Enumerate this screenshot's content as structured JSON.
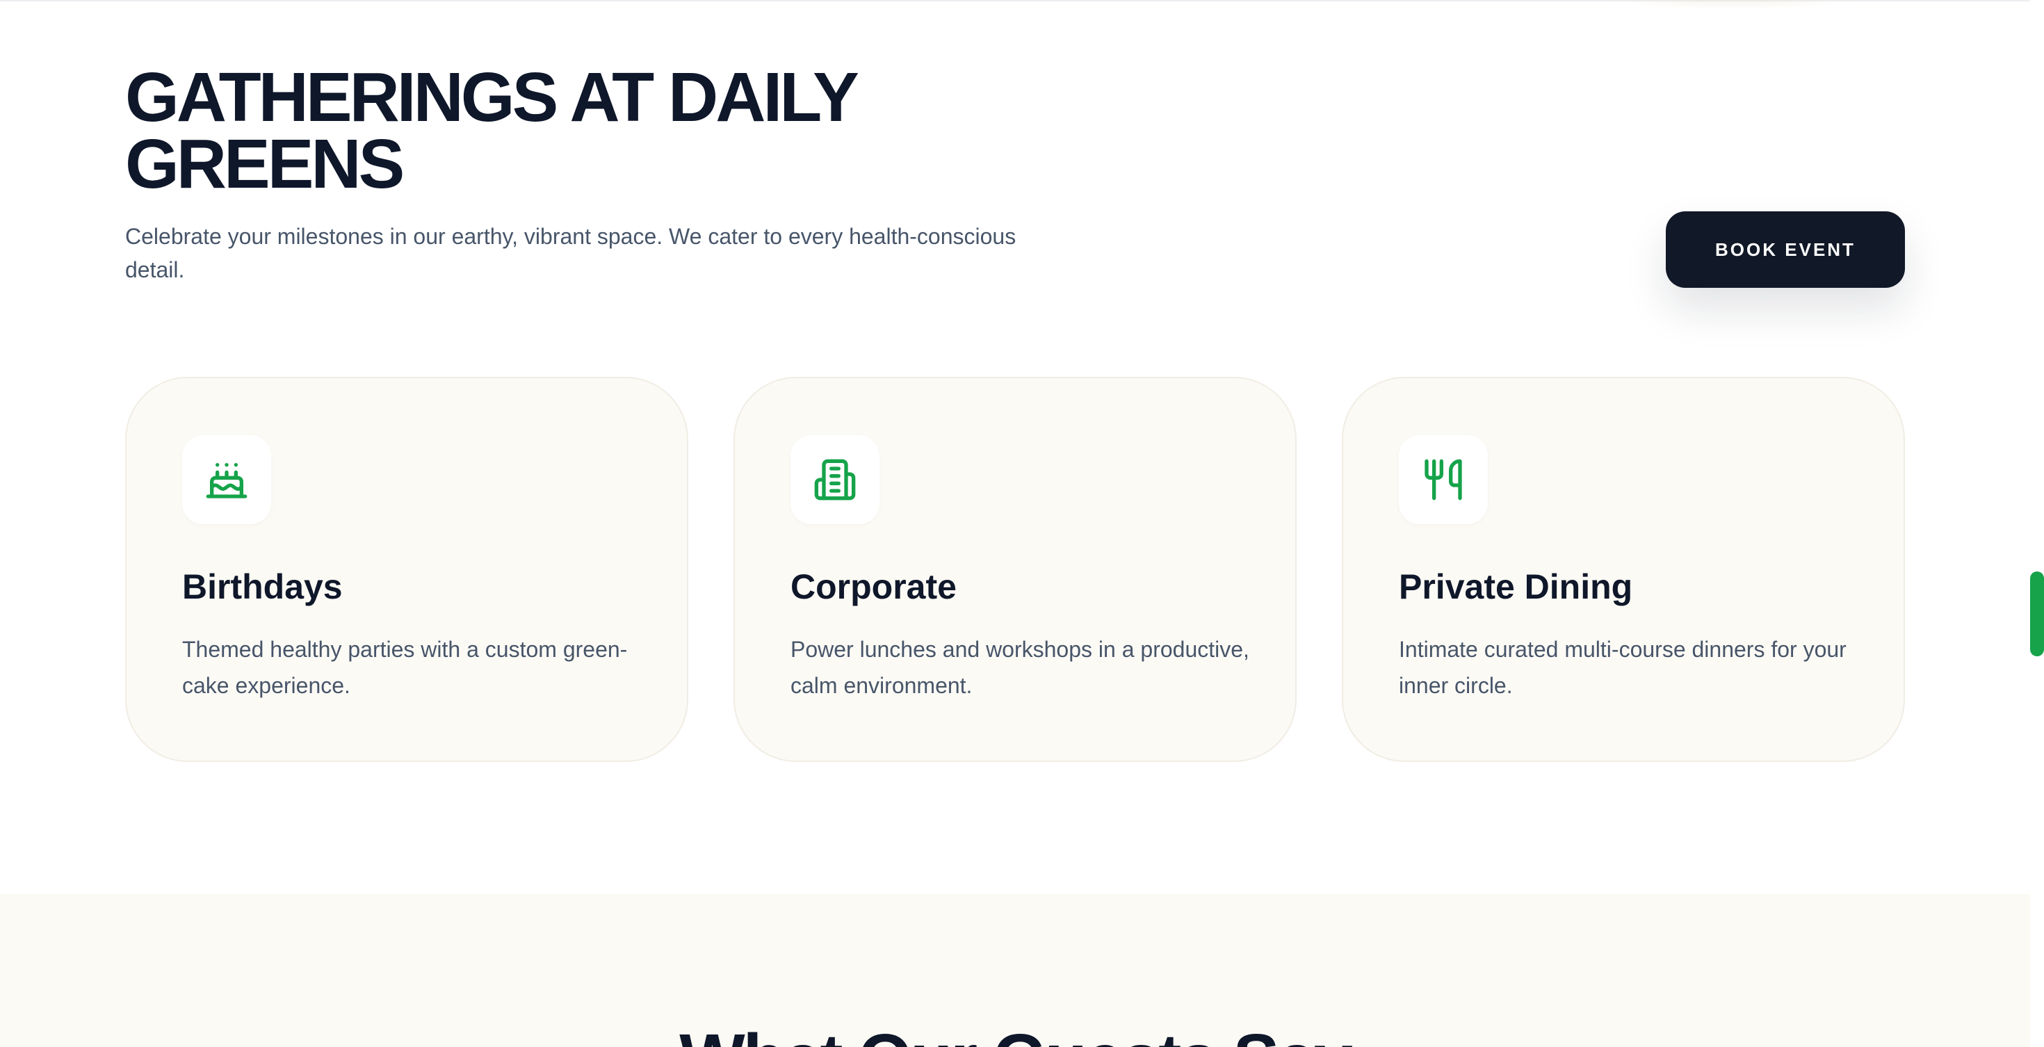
{
  "section": {
    "title": "GATHERINGS AT DAILY GREENS",
    "subtitle": "Celebrate your milestones in our earthy, vibrant space. We cater to every health-conscious detail.",
    "cta_label": "BOOK EVENT"
  },
  "cards": [
    {
      "icon": "cake-icon",
      "title": "Birthdays",
      "description": "Themed healthy parties with a custom green-cake experience."
    },
    {
      "icon": "building-icon",
      "title": "Corporate",
      "description": "Power lunches and workshops in a productive, calm environment."
    },
    {
      "icon": "utensils-icon",
      "title": "Private Dining",
      "description": "Intimate curated multi-course dinners for your inner circle."
    }
  ],
  "next_section": {
    "title": "What Our Guests Say"
  },
  "colors": {
    "accent": "#16a34a",
    "dark": "#111827",
    "card_bg": "#fcfaf5",
    "text_muted": "#475569"
  }
}
